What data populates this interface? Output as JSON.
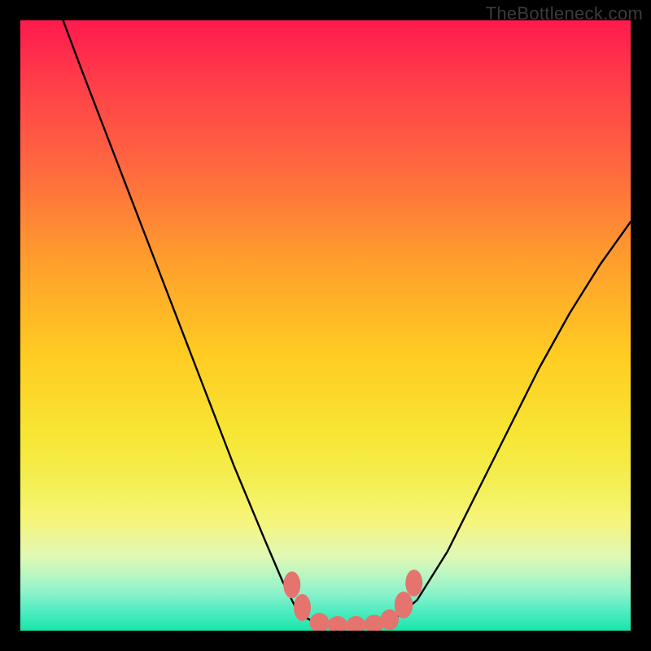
{
  "watermark": "TheBottleneck.com",
  "chart_data": {
    "type": "line",
    "title": "",
    "xlabel": "",
    "ylabel": "",
    "xlim": [
      0,
      100
    ],
    "ylim": [
      0,
      100
    ],
    "grid": false,
    "legend": false,
    "annotations": [],
    "series": [
      {
        "name": "curve-left",
        "stroke": "#000000",
        "x": [
          7,
          10,
          15,
          20,
          25,
          30,
          35,
          40,
          43,
          45,
          47,
          49
        ],
        "y": [
          100,
          92,
          79,
          66,
          53,
          40,
          27,
          15,
          8,
          4,
          2,
          1
        ]
      },
      {
        "name": "flat-bottom",
        "stroke": "#000000",
        "x": [
          49,
          52,
          55,
          58,
          60
        ],
        "y": [
          1,
          0.6,
          0.6,
          0.8,
          1.2
        ]
      },
      {
        "name": "curve-right",
        "stroke": "#000000",
        "x": [
          60,
          62,
          65,
          70,
          75,
          80,
          85,
          90,
          95,
          100
        ],
        "y": [
          1.2,
          2.5,
          5,
          13,
          23,
          33,
          43,
          52,
          60,
          67
        ]
      }
    ],
    "markers": {
      "color": "#e5746e",
      "points": [
        {
          "x": 44.5,
          "y": 7.5,
          "rx": 1.4,
          "ry": 2.2
        },
        {
          "x": 46.2,
          "y": 3.8,
          "rx": 1.4,
          "ry": 2.2
        },
        {
          "x": 49.0,
          "y": 1.3,
          "rx": 1.6,
          "ry": 1.6
        },
        {
          "x": 52.0,
          "y": 0.9,
          "rx": 1.6,
          "ry": 1.5
        },
        {
          "x": 55.0,
          "y": 0.9,
          "rx": 1.6,
          "ry": 1.5
        },
        {
          "x": 58.0,
          "y": 1.1,
          "rx": 1.6,
          "ry": 1.5
        },
        {
          "x": 60.5,
          "y": 1.8,
          "rx": 1.5,
          "ry": 1.7
        },
        {
          "x": 62.8,
          "y": 4.2,
          "rx": 1.5,
          "ry": 2.2
        },
        {
          "x": 64.5,
          "y": 7.8,
          "rx": 1.4,
          "ry": 2.2
        }
      ]
    }
  }
}
